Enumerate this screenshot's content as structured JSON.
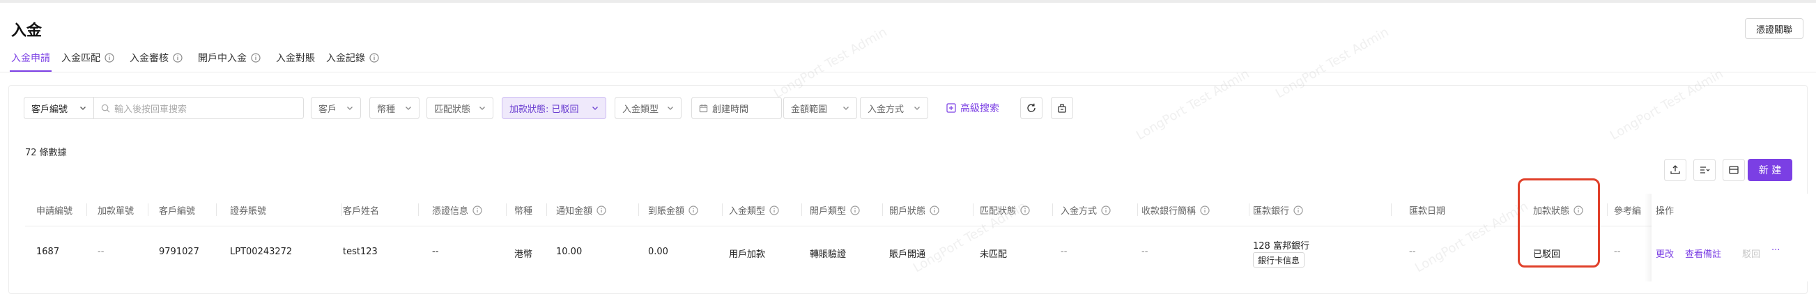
{
  "page": {
    "title": "入金",
    "voucher_button": "憑證關聯"
  },
  "tabs": [
    {
      "label": "入金申請",
      "active": true,
      "info": false
    },
    {
      "label": "入金匹配",
      "active": false,
      "info": true
    },
    {
      "label": "入金審核",
      "active": false,
      "info": true
    },
    {
      "label": "開戶中入金",
      "active": false,
      "info": true
    },
    {
      "label": "入金對賬",
      "active": false,
      "info": false
    },
    {
      "label": "入金記錄",
      "active": false,
      "info": true
    }
  ],
  "filters": {
    "search_field": "客戶編號",
    "search_placeholder": "輸入後按回車搜索",
    "client": "客戶",
    "currency": "幣種",
    "match_status": "匹配狀態",
    "add_status": "加款狀態: 已駁回",
    "deposit_type": "入金類型",
    "created_time": "創建時間",
    "amount_range": "金額範圍",
    "deposit_method": "入金方式",
    "advanced_search": "高級搜索"
  },
  "summary": {
    "count": "72 條數據"
  },
  "toolbar": {
    "new_button": "新 建"
  },
  "table": {
    "columns": [
      {
        "label": "申請編號",
        "info": false
      },
      {
        "label": "加款單號",
        "info": false
      },
      {
        "label": "客戶編號",
        "info": false
      },
      {
        "label": "證券賬號",
        "info": false
      },
      {
        "label": "客戶姓名",
        "info": false
      },
      {
        "label": "憑證信息",
        "info": true
      },
      {
        "label": "幣種",
        "info": false
      },
      {
        "label": "通知金額",
        "info": true
      },
      {
        "label": "到賬金額",
        "info": true
      },
      {
        "label": "入金類型",
        "info": true
      },
      {
        "label": "開戶類型",
        "info": true
      },
      {
        "label": "開戶狀態",
        "info": true
      },
      {
        "label": "匹配狀態",
        "info": true
      },
      {
        "label": "入金方式",
        "info": true
      },
      {
        "label": "收款銀行簡稱",
        "info": true
      },
      {
        "label": "匯款銀行",
        "info": true
      },
      {
        "label": "匯款日期",
        "info": false
      },
      {
        "label": "加款狀態",
        "info": true
      },
      {
        "label": "參考編",
        "info": false
      },
      {
        "label": "操作",
        "info": false
      }
    ],
    "rows": [
      {
        "application_no": "1687",
        "add_no": "--",
        "client_no": "9791027",
        "securities_account": "LPT00243272",
        "client_name": "test123",
        "voucher_info": "--",
        "currency": "港幣",
        "notice_amount": "10.00",
        "arrival_amount": "0.00",
        "deposit_type": "用戶加款",
        "account_type": "轉賬驗證",
        "account_status": "賬戶開通",
        "match_status": "未匹配",
        "deposit_method": "--",
        "receiving_bank": "--",
        "remit_bank": "128 富邦銀行",
        "remit_bank_tag": "銀行卡信息",
        "remit_date": "--",
        "add_status": "已駁回",
        "reference": "--",
        "ops": {
          "edit": "更改",
          "view_note": "查看備註",
          "reject": "駁回",
          "more": "···"
        }
      }
    ]
  },
  "watermark": "LongPort Test Admin",
  "colors": {
    "accent": "#7b3fe4",
    "highlight": "#e0402a"
  }
}
